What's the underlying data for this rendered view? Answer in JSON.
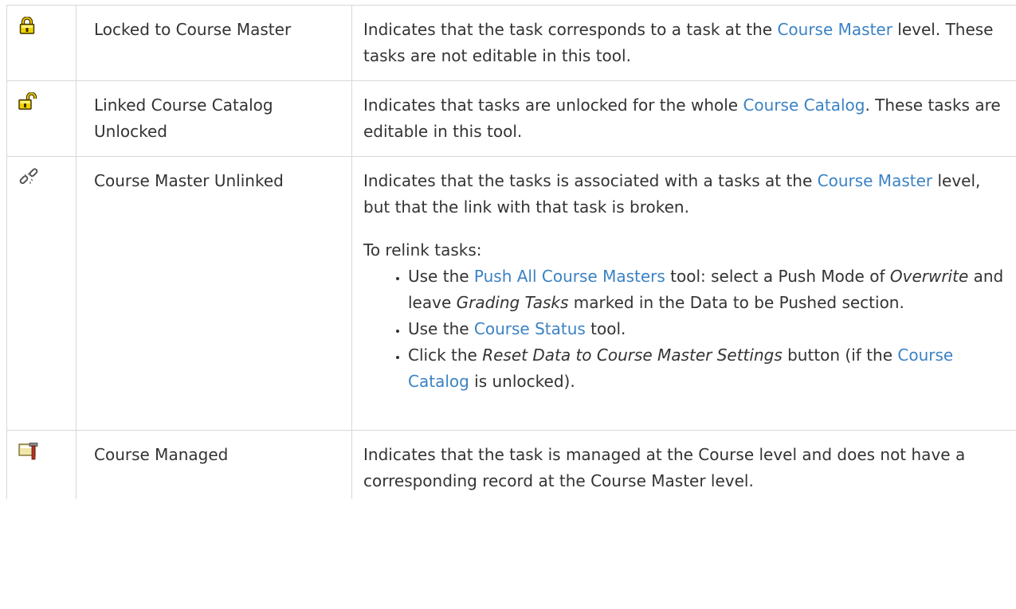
{
  "rows": [
    {
      "icon": "yellow-lock-icon",
      "name": "Locked to Course Master",
      "desc": {
        "t1": "Indicates that the task corresponds to a task at the ",
        "link1": "Course Master",
        "t2": " level. These tasks are not editable in this tool."
      }
    },
    {
      "icon": "yellow-unlock-icon",
      "name": "Linked Course Catalog Unlocked",
      "desc": {
        "t1": "Indicates that tasks are unlocked for the whole ",
        "link1": "Course Catalog",
        "t2": ". These tasks are editable in this tool."
      }
    },
    {
      "icon": "broken-link-icon",
      "name": "Course Master Unlinked",
      "desc": {
        "t1": "Indicates that the tasks is associated with a tasks at the ",
        "link1": "Course Master",
        "t2": " level, but that the link with that task is broken.",
        "intro": "To relink tasks:",
        "bullets": [
          {
            "t1": "Use the ",
            "link": "Push All Course Masters",
            "t2": " tool: select a Push Mode of ",
            "em1": "Overwrite",
            "t3": " and leave ",
            "em2": "Grading Tasks",
            "t4": " marked in the Data to be Pushed section."
          },
          {
            "t1": "Use the ",
            "link": "Course Status",
            "t2": " tool."
          },
          {
            "t1": "Click the ",
            "em1": "Reset Data to Course Master Settings",
            "t2": " button (if the ",
            "link": "Course Catalog",
            "t3": " is unlocked)."
          }
        ]
      }
    },
    {
      "icon": "course-managed-icon",
      "name": "Course Managed",
      "desc": {
        "t1": "Indicates that the task is managed at the Course level and does not have a corresponding record at the Course Master level."
      }
    }
  ],
  "colors": {
    "link": "#3b82c4",
    "text": "#333333",
    "border": "#d8d8d8"
  }
}
